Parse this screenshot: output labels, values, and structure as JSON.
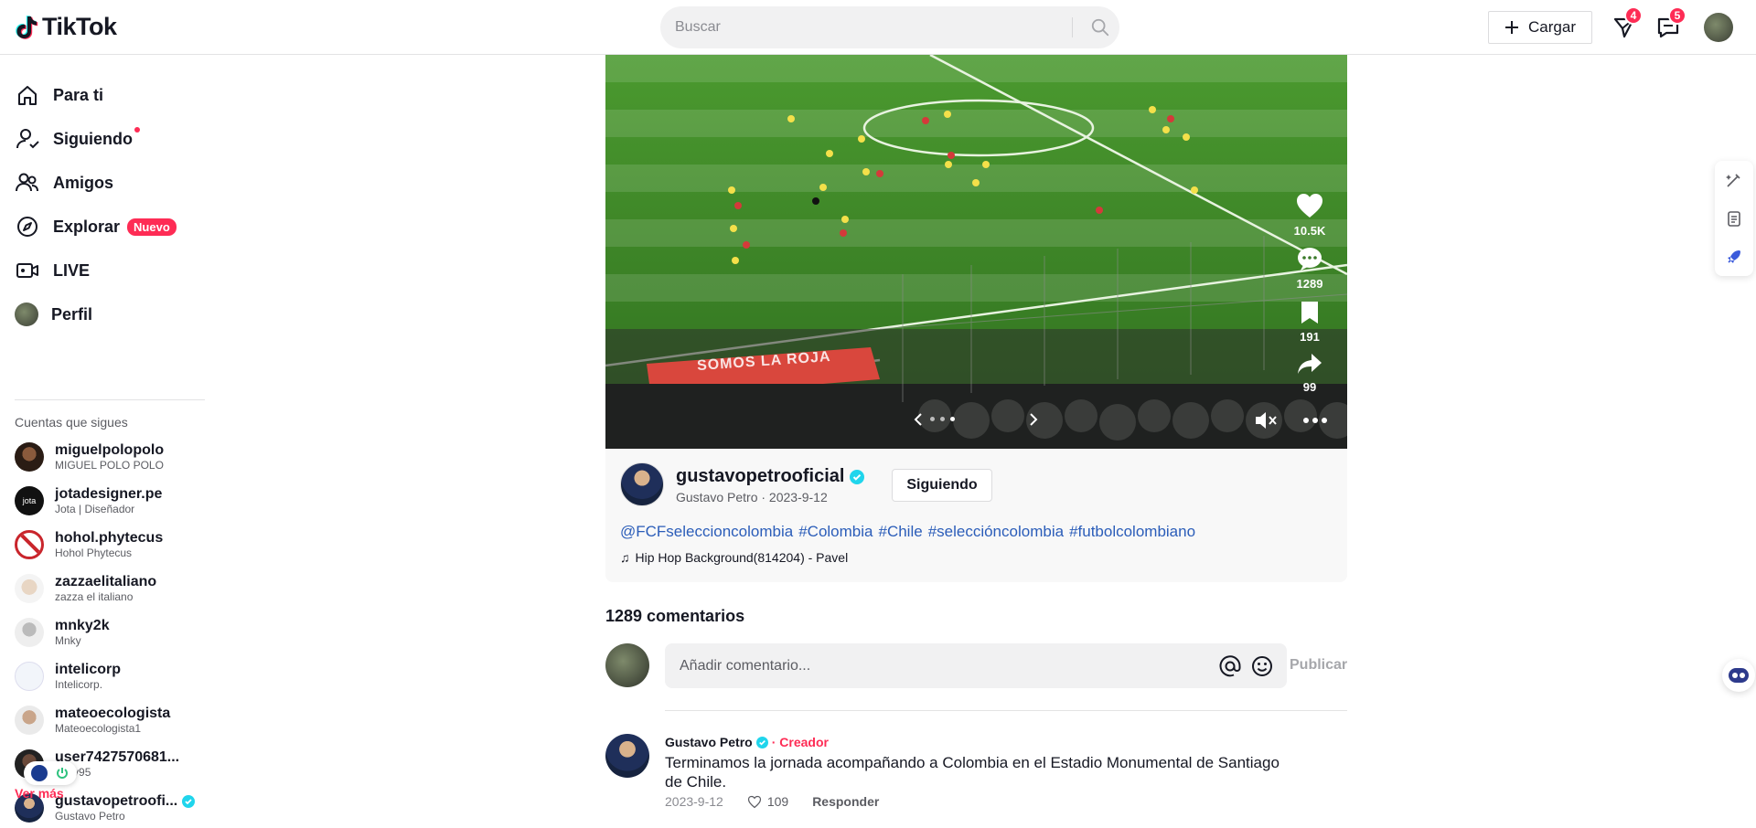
{
  "header": {
    "logo_text": "TikTok",
    "search_placeholder": "Buscar",
    "upload_label": "Cargar",
    "inbox_badge": "4",
    "messages_badge": "5"
  },
  "sidebar": {
    "nav": [
      {
        "label": "Para ti",
        "icon": "home-icon"
      },
      {
        "label": "Siguiendo",
        "icon": "following-icon"
      },
      {
        "label": "Amigos",
        "icon": "friends-icon"
      },
      {
        "label": "Explorar",
        "icon": "compass-icon",
        "badge": "Nuevo"
      },
      {
        "label": "LIVE",
        "icon": "live-icon"
      },
      {
        "label": "Perfil",
        "icon": "avatar"
      }
    ],
    "following_title": "Cuentas que sigues",
    "accounts": [
      {
        "name": "miguelpolopolo",
        "sub": "MIGUEL POLO POLO"
      },
      {
        "name": "jotadesigner.pe",
        "sub": "Jota | Diseñador"
      },
      {
        "name": "hohol.phytecus",
        "sub": "Hohol Phytecus"
      },
      {
        "name": "zazzaelitaliano",
        "sub": "zazza el italiano"
      },
      {
        "name": "mnky2k",
        "sub": "Mnky"
      },
      {
        "name": "intelicorp",
        "sub": "Intelicorp."
      },
      {
        "name": "mateoecologista",
        "sub": "Mateoecologista1"
      },
      {
        "name": "user7427570681...",
        "sub": "eddy95"
      },
      {
        "name": "gustavopetroofi...",
        "sub": "Gustavo Petro"
      }
    ],
    "see_more": "Ver más"
  },
  "video": {
    "banner_text": "SOMOS LA ROJA",
    "likes": "10.5K",
    "comments": "1289",
    "saves": "191",
    "shares": "99"
  },
  "post": {
    "author_handle": "gustavopetrooficial",
    "author_meta": "Gustavo Petro · 2023-9-12",
    "follow_state": "Siguiendo",
    "tags": [
      "@FCFseleccioncolombia",
      "#Colombia",
      "#Chile",
      "#seleccióncolombia",
      "#futbolcolombiano"
    ],
    "music": "Hip Hop Background(814204) - Pavel"
  },
  "comments": {
    "count_label": "1289 comentarios",
    "input_placeholder": "Añadir comentario...",
    "publish_label": "Publicar",
    "items": [
      {
        "author": "Gustavo Petro",
        "creator_tag": "· Creador",
        "text": "Terminamos la jornada acompañando a Colombia en el Estadio Monumental de Santiago de Chile.",
        "date": "2023-9-12",
        "likes": "109",
        "reply": "Responder"
      }
    ]
  },
  "colors": {
    "accent": "#fe2c55",
    "verified": "#20d5ec",
    "tag_blue": "#2b5db9"
  }
}
